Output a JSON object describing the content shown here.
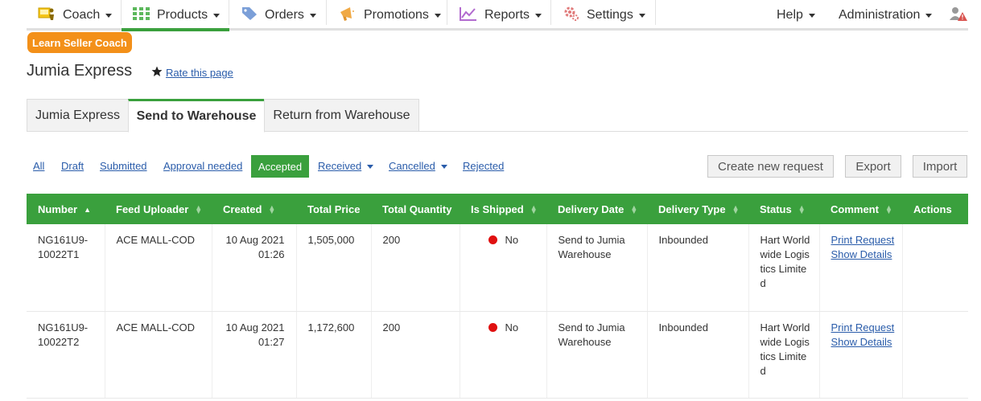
{
  "nav": {
    "coach": "Coach",
    "products": "Products",
    "orders": "Orders",
    "promotions": "Promotions",
    "reports": "Reports",
    "settings": "Settings",
    "help": "Help",
    "administration": "Administration"
  },
  "badge": "Learn Seller Coach",
  "page_title": "Jumia Express",
  "rate_label": "Rate this page",
  "tabs": [
    "Jumia Express",
    "Send to Warehouse",
    "Return from Warehouse"
  ],
  "filters": {
    "all": "All",
    "draft": "Draft",
    "submitted": "Submitted",
    "approval": "Approval needed",
    "accepted": "Accepted",
    "received": "Received",
    "cancelled": "Cancelled",
    "rejected": "Rejected"
  },
  "buttons": {
    "create": "Create new request",
    "export": "Export",
    "import": "Import"
  },
  "columns": [
    "Number",
    "Feed Uploader",
    "Created",
    "Total Price",
    "Total Quantity",
    "Is Shipped",
    "Delivery Date",
    "Delivery Type",
    "Status",
    "Comment",
    "Actions"
  ],
  "rows": [
    {
      "number": "NG161U9-10022T1",
      "uploader": "ACE MALL-COD",
      "created": "10 Aug 2021 01:26",
      "price": "1,505,000",
      "qty": "200",
      "shipped": "No",
      "delivery_date": "Send to Jumia Warehouse",
      "delivery_type": "Inbounded",
      "status": "Hart Worldwide Logistics Limited",
      "link1": "Print Request",
      "link2": "Show Details"
    },
    {
      "number": "NG161U9-10022T2",
      "uploader": "ACE MALL-COD",
      "created": "10 Aug 2021 01:27",
      "price": "1,172,600",
      "qty": "200",
      "shipped": "No",
      "delivery_date": "Send to Jumia Warehouse",
      "delivery_type": "Inbounded",
      "status": "Hart Worldwide Logistics Limited",
      "link1": "Print Request",
      "link2": "Show Details"
    }
  ],
  "colors": {
    "accent": "#3aa03d",
    "badge": "#f39019",
    "link": "#2a5caa",
    "shipped_no": "#e01010"
  }
}
